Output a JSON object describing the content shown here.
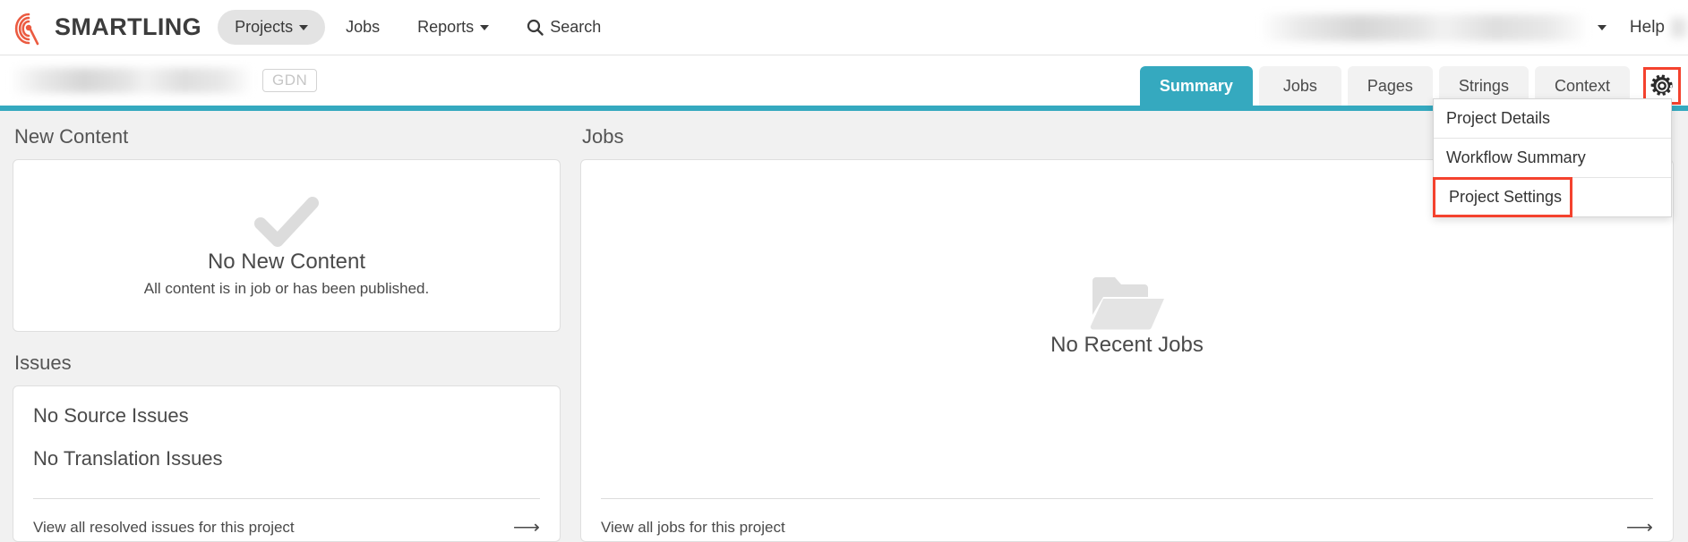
{
  "brand": {
    "name": "SMARTLING",
    "logo_icon": "smartling-fingerprint-logo"
  },
  "topnav": {
    "items": [
      {
        "label": "Projects",
        "has_caret": true,
        "active": true
      },
      {
        "label": "Jobs",
        "has_caret": false,
        "active": false
      },
      {
        "label": "Reports",
        "has_caret": true,
        "active": false
      },
      {
        "label": "Search",
        "has_caret": false,
        "active": false,
        "icon": "search-icon"
      }
    ],
    "account_redacted": "",
    "account_caret_icon": "chevron-down-icon",
    "help_label": "Help"
  },
  "subnav": {
    "project_name_redacted": "",
    "badge": "GDN",
    "tabs": [
      {
        "label": "Summary",
        "active": true
      },
      {
        "label": "Jobs",
        "active": false
      },
      {
        "label": "Pages",
        "active": false
      },
      {
        "label": "Strings",
        "active": false
      },
      {
        "label": "Context",
        "active": false
      }
    ],
    "gear_icon": "gear-icon"
  },
  "gear_menu": {
    "items": [
      {
        "label": "Project Details",
        "highlighted": false
      },
      {
        "label": "Workflow Summary",
        "highlighted": false
      },
      {
        "label": "Project Settings",
        "highlighted": true
      }
    ]
  },
  "main": {
    "new_content": {
      "heading": "New Content",
      "icon": "checkmark-icon",
      "title": "No New Content",
      "subtitle": "All content is in job or has been published."
    },
    "issues": {
      "heading": "Issues",
      "lines": [
        "No Source Issues",
        "No Translation Issues"
      ],
      "footer_link": "View all resolved issues for this project",
      "footer_arrow_icon": "arrow-right-icon"
    },
    "jobs": {
      "heading": "Jobs",
      "icon": "open-folder-icon",
      "empty_title": "No Recent Jobs",
      "footer_link": "View all jobs for this project",
      "footer_arrow_icon": "arrow-right-icon"
    }
  },
  "colors": {
    "accent_teal": "#35a9bf",
    "highlight_red": "#f4422e",
    "brand_orange": "#eb5b41",
    "page_bg": "#f1f1f1",
    "text_dark": "#4a4a4a"
  }
}
